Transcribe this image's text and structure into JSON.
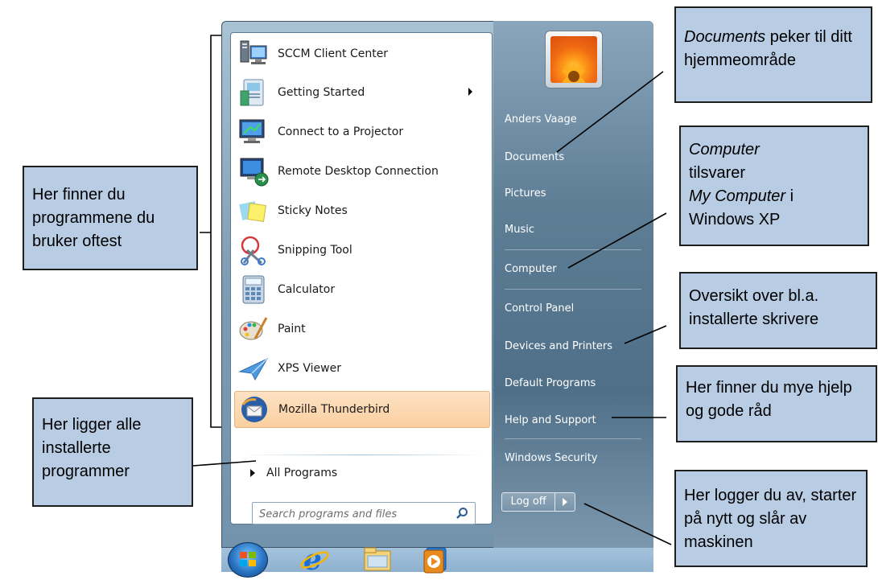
{
  "programs": [
    {
      "label": "SCCM Client Center",
      "icon": "sccm-client-center-icon"
    },
    {
      "label": "Getting Started",
      "icon": "getting-started-icon",
      "has_submenu": true
    },
    {
      "label": "Connect to a Projector",
      "icon": "projector-icon"
    },
    {
      "label": "Remote Desktop Connection",
      "icon": "remote-desktop-icon"
    },
    {
      "label": "Sticky Notes",
      "icon": "sticky-notes-icon"
    },
    {
      "label": "Snipping Tool",
      "icon": "snipping-tool-icon"
    },
    {
      "label": "Calculator",
      "icon": "calculator-icon"
    },
    {
      "label": "Paint",
      "icon": "paint-icon"
    },
    {
      "label": "XPS Viewer",
      "icon": "xps-viewer-icon"
    },
    {
      "label": "Mozilla Thunderbird",
      "icon": "thunderbird-icon",
      "highlighted": true
    }
  ],
  "all_programs_label": "All Programs",
  "search": {
    "placeholder": "Search programs and files"
  },
  "right_items": [
    {
      "label": "Anders Vaage"
    },
    {
      "label": "Documents"
    },
    {
      "label": "Pictures"
    },
    {
      "label": "Music"
    },
    {
      "label": "Computer"
    },
    {
      "label": "Control Panel"
    },
    {
      "label": "Devices and Printers"
    },
    {
      "label": "Default Programs"
    },
    {
      "label": "Help and Support"
    },
    {
      "label": "Windows Security"
    }
  ],
  "logoff": {
    "label": "Log off"
  },
  "taskbar_icons": [
    "start-orb-icon",
    "internet-explorer-icon",
    "file-explorer-icon",
    "media-player-icon"
  ],
  "callouts": {
    "frequent": {
      "text": "Her finner du programmene du bruker oftest"
    },
    "all_programs": {
      "text": "Her ligger alle installerte programmer"
    },
    "documents": {
      "em": "Documents",
      "text": " peker til ditt hjemmeområde"
    },
    "computer": {
      "em1": "Computer",
      "mid": " tilsvarer ",
      "em2": "My Computer",
      "end": " i Windows XP"
    },
    "devices": {
      "text": "Oversikt over bl.a. installerte skrivere"
    },
    "help": {
      "text": "Her finner du mye hjelp og gode råd"
    },
    "logoff": {
      "text": "Her logger du av, starter på nytt og slår av maskinen"
    }
  },
  "colors": {
    "callout_fill": "#b8cce4",
    "highlight": "#fbcfa0",
    "menu_frame": "#7e9cb3"
  }
}
